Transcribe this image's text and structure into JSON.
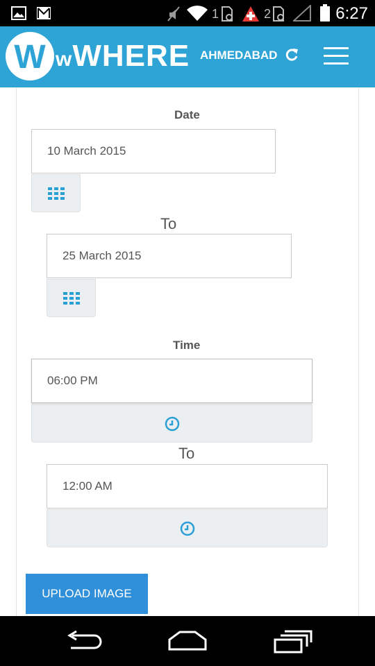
{
  "status_bar": {
    "time": "6:27",
    "sim1_label": "1",
    "sim2_label": "2",
    "icons": [
      "image-icon",
      "gmail-icon",
      "mute-icon",
      "wifi-icon",
      "sim1-icon",
      "alert-icon",
      "sim2-icon",
      "signal-icon",
      "battery-icon"
    ]
  },
  "app_bar": {
    "logo_letter": "W",
    "logo_small": "w",
    "logo_text": "WHERE",
    "city": "AHMEDABAD",
    "refresh_icon": "refresh-icon",
    "menu_icon": "hamburger-menu-icon",
    "brand_color": "#2ea3d5"
  },
  "form": {
    "date_label": "Date",
    "date_from": "10 March 2015",
    "date_to_word": "To",
    "date_to": "25 March 2015",
    "calendar_icon": "calendar-grid-icon",
    "time_label": "Time",
    "time_from": "06:00 PM",
    "time_to_word": "To",
    "time_to": "12:00 AM",
    "clock_icon": "clock-icon",
    "accent_color": "#2a9fd6",
    "upload_label": "UPLOAD IMAGE",
    "upload_color": "#2f8fd9"
  },
  "nav_bar": {
    "back_icon": "back-icon",
    "home_icon": "home-icon",
    "recents_icon": "recents-icon"
  }
}
